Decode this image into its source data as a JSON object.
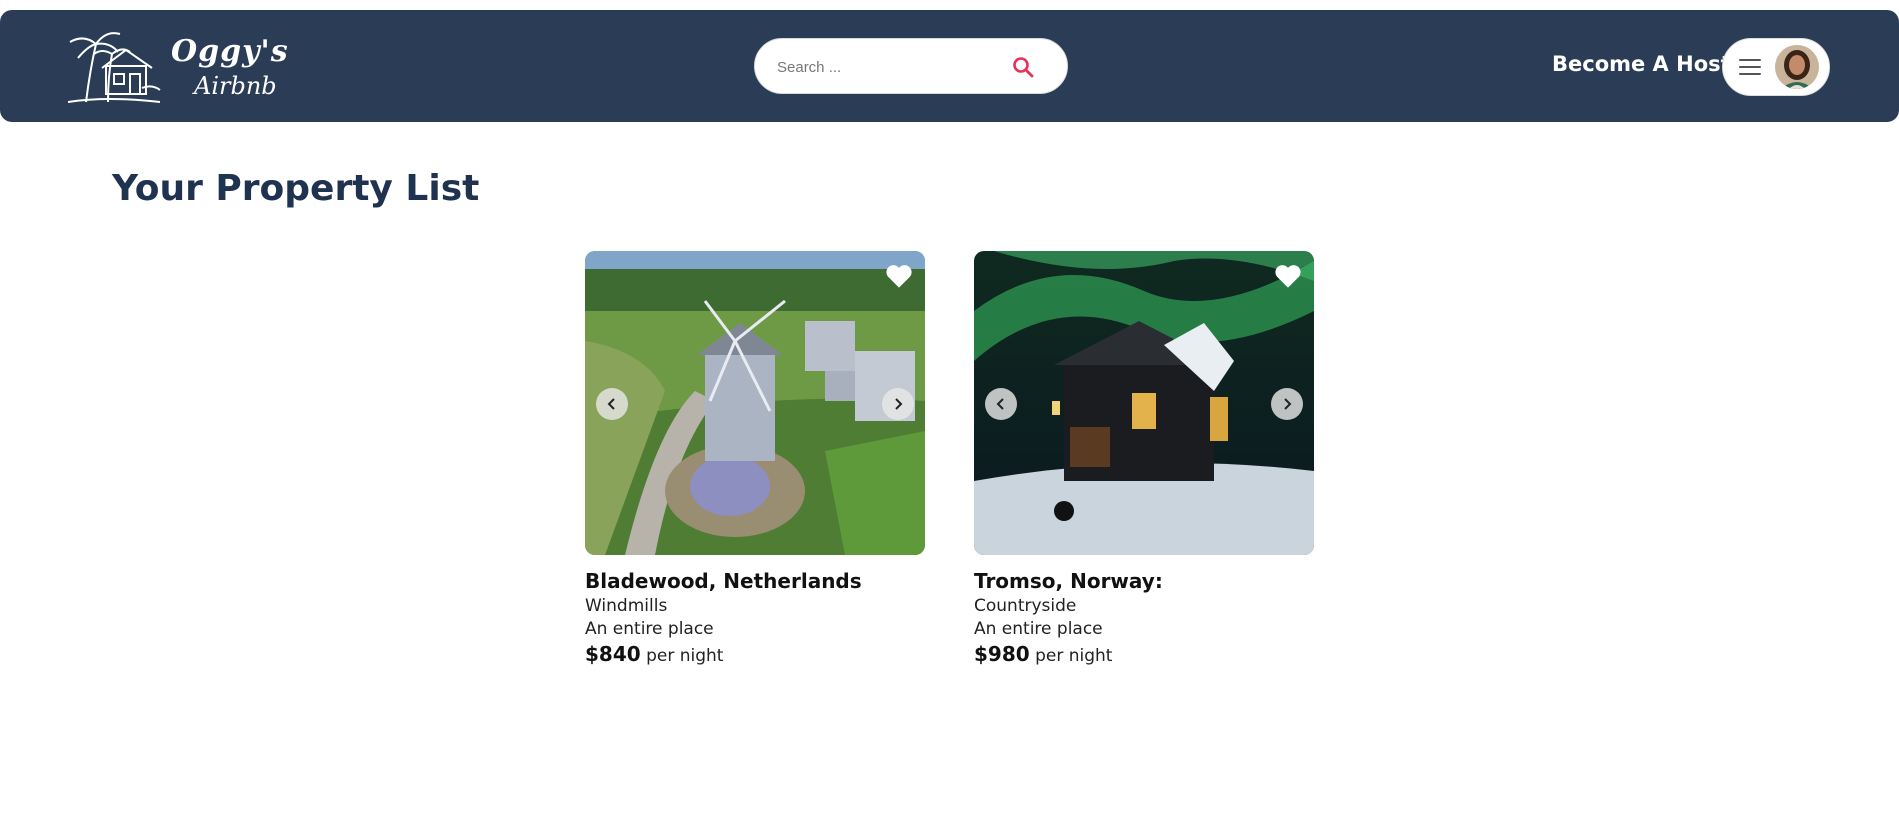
{
  "brand": {
    "line1": "Oggy's",
    "line2": "Airbnb"
  },
  "header": {
    "search_placeholder": "Search ...",
    "host_link": "Become A Host"
  },
  "main": {
    "title": "Your Property List"
  },
  "properties": [
    {
      "title": "Bladewood, Netherlands",
      "category": "Windmills",
      "type": "An entire place",
      "price": "$840",
      "price_unit": "per night"
    },
    {
      "title": "Tromso, Norway:",
      "category": "Countryside",
      "type": "An entire place",
      "price": "$980",
      "price_unit": "per night"
    }
  ],
  "colors": {
    "navbar": "#2b3d56",
    "title": "#1f3351",
    "search_accent": "#e8315a"
  },
  "icons": {
    "search": "search-icon",
    "menu": "hamburger-icon",
    "favorite": "heart-icon",
    "prev": "chevron-left-icon",
    "next": "chevron-right-icon"
  }
}
